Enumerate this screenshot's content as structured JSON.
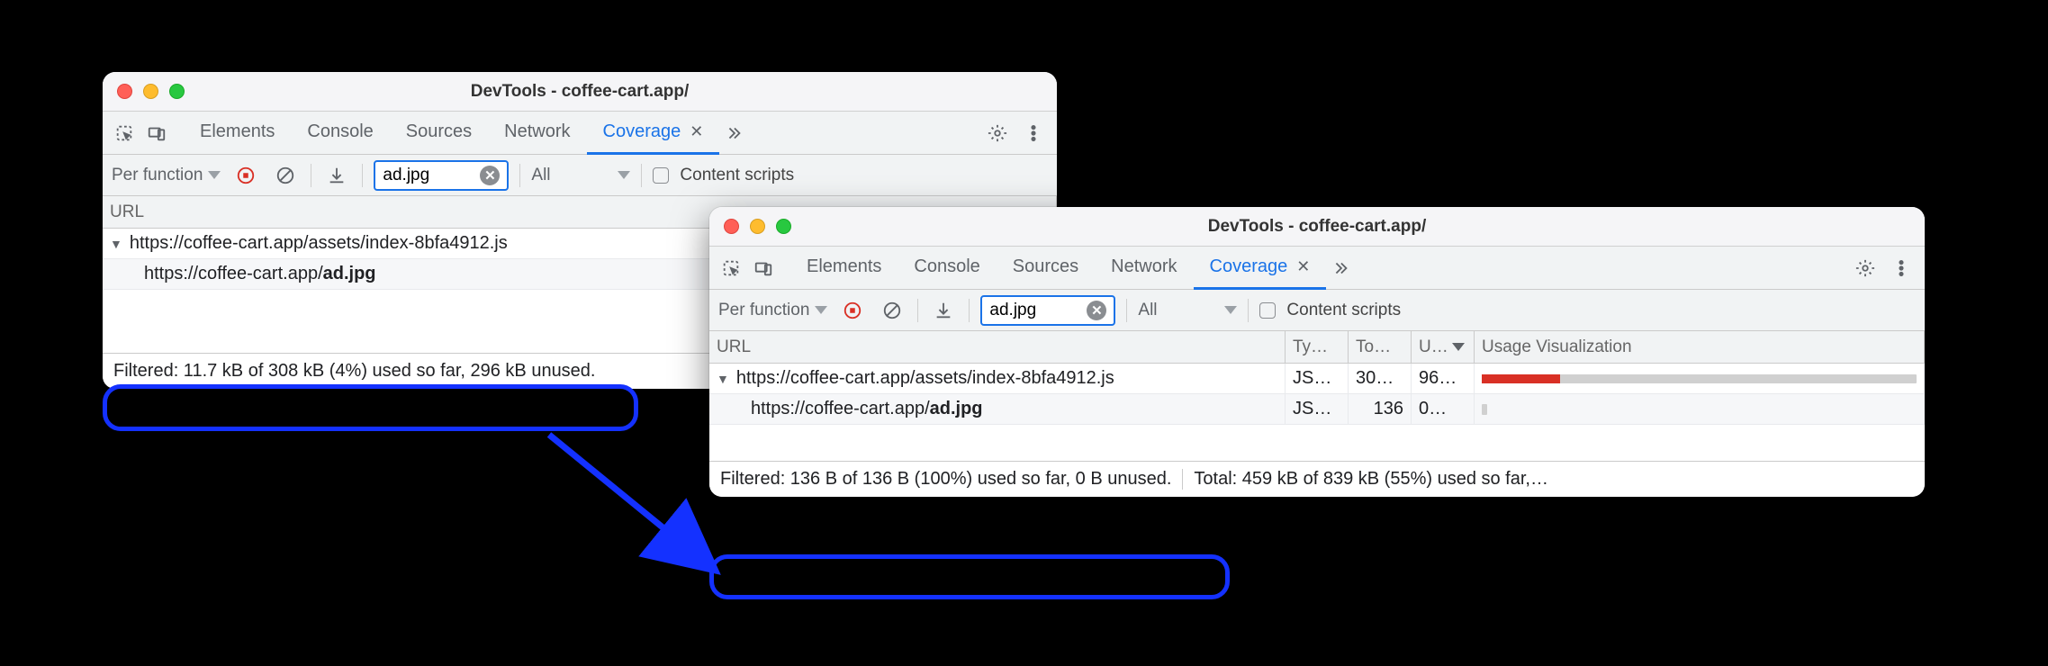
{
  "windows": {
    "left": {
      "title": "DevTools - coffee-cart.app/",
      "tabs": [
        "Elements",
        "Console",
        "Sources",
        "Network",
        "Coverage"
      ],
      "active_tab": "Coverage",
      "toolbar": {
        "granularity": "Per function",
        "filter_value": "ad.jpg",
        "type_filter": "All",
        "content_scripts_label": "Content scripts"
      },
      "columns": {
        "url": "URL"
      },
      "rows": [
        {
          "url_prefix": "https://coffee-cart.app/assets/index-8bfa4912.js",
          "url_bold": "",
          "has_children": true
        },
        {
          "url_prefix": "https://coffee-cart.app/",
          "url_bold": "ad.jpg",
          "has_children": false
        }
      ],
      "status_filtered": "Filtered: 11.7 kB of 308 kB (4%) used so far, 296 kB unused."
    },
    "right": {
      "title": "DevTools - coffee-cart.app/",
      "tabs": [
        "Elements",
        "Console",
        "Sources",
        "Network",
        "Coverage"
      ],
      "active_tab": "Coverage",
      "toolbar": {
        "granularity": "Per function",
        "filter_value": "ad.jpg",
        "type_filter": "All",
        "content_scripts_label": "Content scripts"
      },
      "columns": {
        "url": "URL",
        "ty": "Ty…",
        "to": "To…",
        "un": "U…",
        "usage": "Usage Visualization"
      },
      "rows": [
        {
          "url_prefix": "https://coffee-cart.app/assets/index-8bfa4912.js",
          "url_bold": "",
          "ty": "JS…",
          "to": "30…",
          "un": "96…",
          "used_pct": 18,
          "has_children": true
        },
        {
          "url_prefix": "https://coffee-cart.app/",
          "url_bold": "ad.jpg",
          "ty": "JS…",
          "to": "136",
          "un": "0…",
          "used_pct": 100,
          "tiny": true,
          "has_children": false
        }
      ],
      "status_filtered": "Filtered: 136 B of 136 B (100%) used so far, 0 B unused.",
      "status_total": "Total: 459 kB of 839 kB (55%) used so far,…"
    }
  }
}
